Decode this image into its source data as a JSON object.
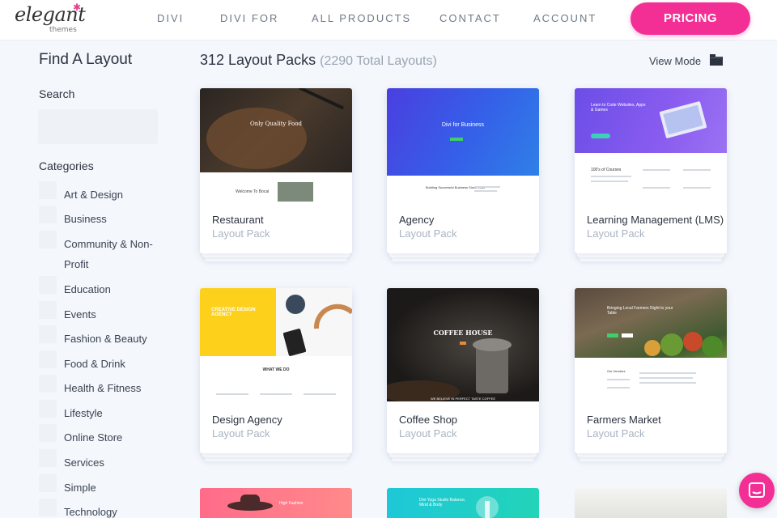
{
  "header": {
    "logo_word": "elegant",
    "logo_sub": "themes",
    "nav": [
      "DIVI",
      "DIVI FOR",
      "ALL PRODUCTS",
      "CONTACT",
      "ACCOUNT"
    ],
    "pricing_label": "PRICING",
    "accent": "#f32f95"
  },
  "sidebar": {
    "title": "Find A Layout",
    "search_label": "Search",
    "search_value": "",
    "categories_title": "Categories",
    "categories": [
      "Art & Design",
      "Business",
      "Community & Non-Profit",
      "Education",
      "Events",
      "Fashion & Beauty",
      "Food & Drink",
      "Health & Fitness",
      "Lifestyle",
      "Online Store",
      "Services",
      "Simple",
      "Technology"
    ]
  },
  "main": {
    "title": "312 Layout Packs",
    "title_count": "(2290 Total Layouts)",
    "view_mode_label": "View Mode",
    "cards": [
      {
        "name": "Restaurant",
        "type": "Layout Pack",
        "hero_text": "Only Quality Food",
        "sub_text": "Welcome To Bocal"
      },
      {
        "name": "Agency",
        "type": "Layout Pack",
        "hero_text": "Divi for Business",
        "sub_text": "Building Successful Business Since 1983"
      },
      {
        "name": "Learning Management (LMS)",
        "type": "Layout Pack",
        "hero_text": "Learn to Code Websites, Apps & Games",
        "sub_text": "100's of Courses"
      },
      {
        "name": "Design Agency",
        "type": "Layout Pack",
        "hero_text": "CREATIVE DESIGN AGENCY",
        "sub_text": "WHAT WE DO"
      },
      {
        "name": "Coffee Shop",
        "type": "Layout Pack",
        "hero_text": "COFFEE HOUSE",
        "sub_text": "WE BELIEVE IN PERFECT TASTE COFFEE"
      },
      {
        "name": "Farmers Market",
        "type": "Layout Pack",
        "hero_text": "Bringing Local Farmers Right to your Table",
        "sub_text": "Our Vendors"
      }
    ],
    "peek_cards": [
      {
        "hero_text": "High Fashion"
      },
      {
        "hero_text": "Divi Yoga Studio Balance, Mind & Body"
      },
      {
        "hero_text": ""
      }
    ]
  }
}
